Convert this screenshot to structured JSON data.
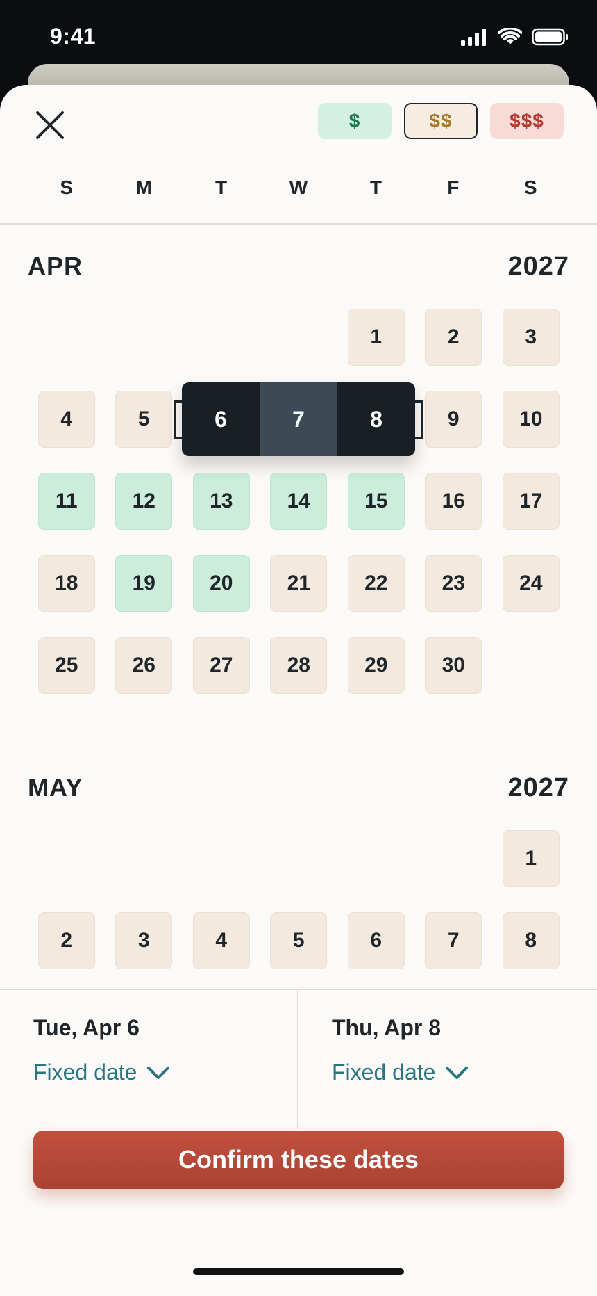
{
  "status_bar": {
    "time": "9:41"
  },
  "price_filters": [
    {
      "label": "$",
      "level": "low"
    },
    {
      "label": "$$",
      "level": "mid",
      "selected": true
    },
    {
      "label": "$$$",
      "level": "high"
    }
  ],
  "weekdays": [
    "S",
    "M",
    "T",
    "W",
    "T",
    "F",
    "S"
  ],
  "months": [
    {
      "name": "APR",
      "year": "2027"
    },
    {
      "name": "MAY",
      "year": "2027"
    }
  ],
  "april_days": [
    {
      "d": "1",
      "c": "mid"
    },
    {
      "d": "2",
      "c": "mid"
    },
    {
      "d": "3",
      "c": "mid"
    },
    {
      "d": "4",
      "c": "mid"
    },
    {
      "d": "5",
      "c": "mid"
    },
    {
      "d": "9",
      "c": "mid"
    },
    {
      "d": "10",
      "c": "mid"
    },
    {
      "d": "11",
      "c": "low"
    },
    {
      "d": "12",
      "c": "low"
    },
    {
      "d": "13",
      "c": "low"
    },
    {
      "d": "14",
      "c": "low"
    },
    {
      "d": "15",
      "c": "low"
    },
    {
      "d": "16",
      "c": "mid"
    },
    {
      "d": "17",
      "c": "mid"
    },
    {
      "d": "18",
      "c": "mid"
    },
    {
      "d": "19",
      "c": "low"
    },
    {
      "d": "20",
      "c": "low"
    },
    {
      "d": "21",
      "c": "mid"
    },
    {
      "d": "22",
      "c": "mid"
    },
    {
      "d": "23",
      "c": "mid"
    },
    {
      "d": "24",
      "c": "mid"
    },
    {
      "d": "25",
      "c": "mid"
    },
    {
      "d": "26",
      "c": "mid"
    },
    {
      "d": "27",
      "c": "mid"
    },
    {
      "d": "28",
      "c": "mid"
    },
    {
      "d": "29",
      "c": "mid"
    },
    {
      "d": "30",
      "c": "mid"
    }
  ],
  "selected_range": [
    "6",
    "7",
    "8"
  ],
  "may_days": [
    {
      "d": "1",
      "c": "mid"
    },
    {
      "d": "2",
      "c": "mid"
    },
    {
      "d": "3",
      "c": "mid"
    },
    {
      "d": "4",
      "c": "mid"
    },
    {
      "d": "5",
      "c": "mid"
    },
    {
      "d": "6",
      "c": "mid"
    },
    {
      "d": "7",
      "c": "mid"
    },
    {
      "d": "8",
      "c": "mid"
    }
  ],
  "start": {
    "label": "Tue, Apr 6",
    "mode": "Fixed date"
  },
  "end": {
    "label": "Thu, Apr 8",
    "mode": "Fixed date"
  },
  "confirm_label": "Confirm these dates"
}
